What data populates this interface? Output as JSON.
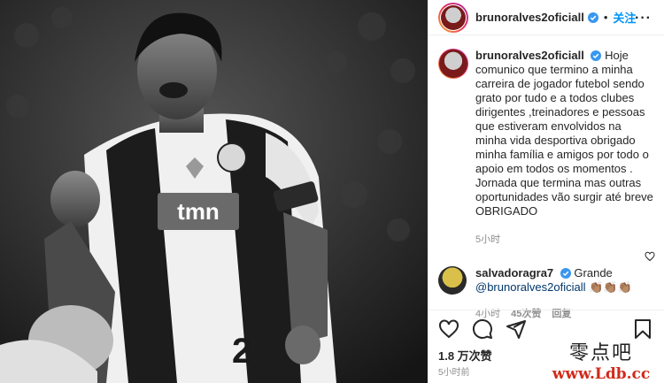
{
  "post": {
    "author": "brunoralves2oficiall",
    "follow_label": "关注",
    "dot": "•",
    "more": "···"
  },
  "caption": {
    "author": "brunoralves2oficiall",
    "text": "Hoje comunico que termino a minha carreira de jogador futebol sendo grato por tudo e a todos clubes dirigentes ,treinadores e pessoas que estiveram envolvidos na minha vida desportiva obrigado minha família e amigos por todo o apoio em todos os momentos . Jornada que termina mas outras oportunidades vão surgir até breve OBRIGADO",
    "time": "5小时"
  },
  "comment": {
    "author": "salvadoragra7",
    "text_prefix": "Grande",
    "mention": "@brunoralves2oficiall",
    "emoji": "👏🏽👏🏽👏🏽",
    "time": "4小时",
    "likes": "45次赞",
    "reply": "回复"
  },
  "footer": {
    "likes": "1.8 万次赞",
    "time": "5小时前"
  },
  "photo": {
    "shirt_sponsor": "tmn"
  },
  "watermark": {
    "line1": "零点吧",
    "line2": "www.Ldb.cc"
  },
  "colors": {
    "link_blue": "#0095f6",
    "verified_blue": "#3897f0",
    "muted": "#8e8e8e"
  }
}
